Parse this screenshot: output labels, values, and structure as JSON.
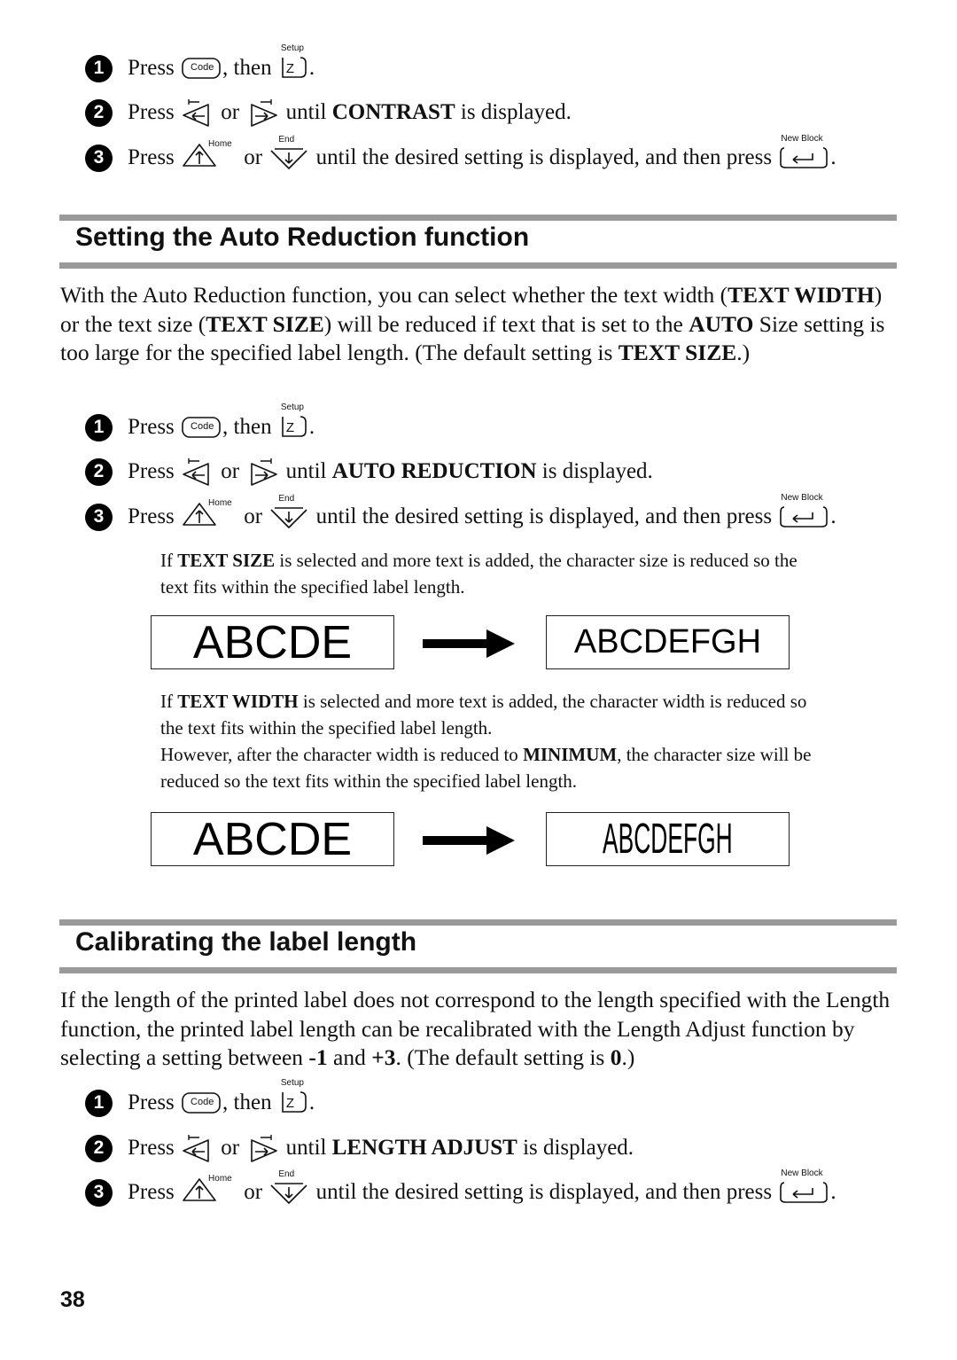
{
  "keys": {
    "code": "Code",
    "setup": "Setup",
    "z": "Z",
    "home": "Home",
    "end": "End",
    "new_block": "New Block"
  },
  "common": {
    "press": "Press ",
    "then": ", then ",
    "period": ".",
    "or": " or ",
    "until": " until ",
    "is_displayed": " is displayed.",
    "step3_text": " until the desired setting is displayed, and then press "
  },
  "top_steps": {
    "step_numbers": [
      "1",
      "2",
      "3"
    ],
    "setting_name": "CONTRAST"
  },
  "section1": {
    "title": "Setting the Auto Reduction function",
    "intro": {
      "p1": "With the Auto Reduction function, you can select whether the text width (",
      "b1": "TEXT WIDTH",
      "p2": ") or the text size (",
      "b2": "TEXT SIZE",
      "p3": ") will be reduced if text that is set to the ",
      "b3": "AUTO",
      "p4": " Size setting is too large for the specified label length. (The default setting is ",
      "b4": "TEXT SIZE",
      "p5": ".)"
    },
    "setting_name": "AUTO REDUCTION",
    "note1": {
      "p1": "If ",
      "b1": "TEXT SIZE",
      "p2": " is selected and more text is added, the character size is reduced so the text fits within the specified label length."
    },
    "example1": {
      "before": "ABCDE",
      "after": "ABCDEFGH"
    },
    "note2": {
      "p1": "If ",
      "b1": "TEXT WIDTH",
      "p2": " is selected and more text is added, the character width is reduced so the text fits within the specified label length.",
      "p3": "However, after the character width is reduced to ",
      "b2": "MINIMUM",
      "p4": ", the character size will be reduced so the text fits within the specified label length."
    },
    "example2": {
      "before": "ABCDE",
      "after": "ABCDEFGH"
    }
  },
  "section2": {
    "title": "Calibrating the label length",
    "intro": {
      "p1": "If the length of the printed label does not correspond to the length specified with the Length function, the printed label length can be recalibrated with the Length Adjust function by selecting a setting between ",
      "b1": "-1",
      "p2": " and ",
      "b2": "+3",
      "p3": ". (The default setting is ",
      "b3": "0",
      "p4": ".)"
    },
    "setting_name": "LENGTH ADJUST"
  },
  "page_number": "38"
}
